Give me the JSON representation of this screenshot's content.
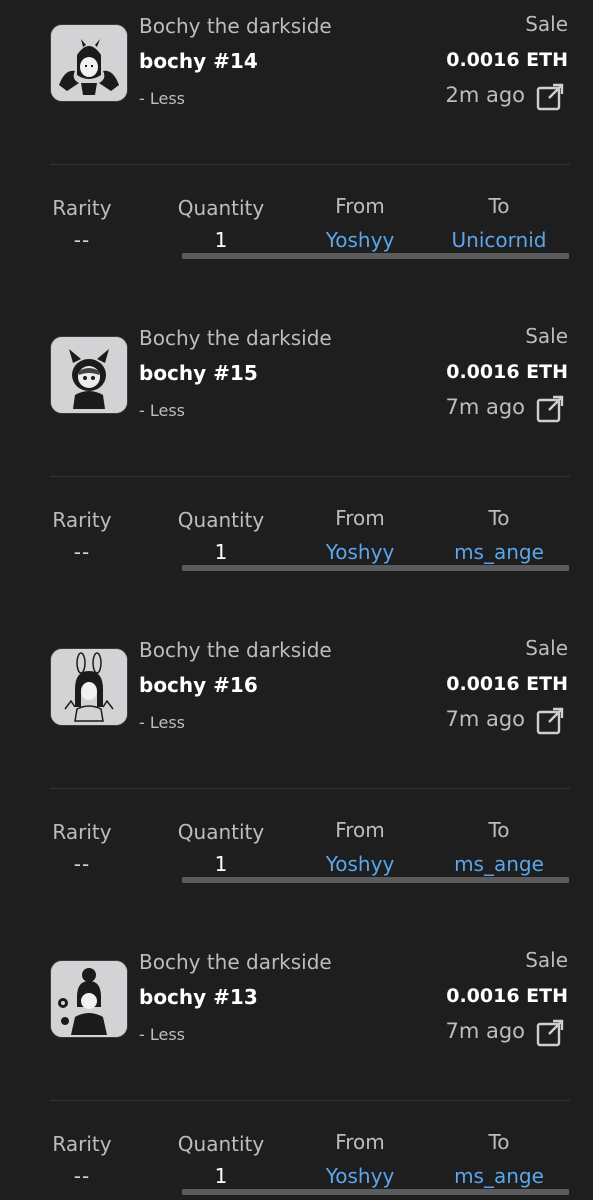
{
  "colors": {
    "background": "#1e1e1f",
    "link": "#5aa6ea",
    "primary_text": "#ffffff",
    "secondary_text": "#bdbdbd",
    "thumbnail_bg": "#d3d3d6"
  },
  "columns": {
    "rarity": "Rarity",
    "quantity": "Quantity",
    "from": "From",
    "to": "To"
  },
  "activities": [
    {
      "collection": "Bochy the darkside",
      "token": "bochy #14",
      "toggle": "- Less",
      "event": "Sale",
      "price": "0.0016 ETH",
      "time": "2m ago",
      "rarity": "--",
      "quantity": "1",
      "from": "Yoshyy",
      "to": "Unicornid",
      "thumbnail_icon": "avatar-bat-wings-icon"
    },
    {
      "collection": "Bochy the darkside",
      "token": "bochy #15",
      "toggle": "- Less",
      "event": "Sale",
      "price": "0.0016 ETH",
      "time": "7m ago",
      "rarity": "--",
      "quantity": "1",
      "from": "Yoshyy",
      "to": "ms_ange",
      "thumbnail_icon": "avatar-devil-horns-icon"
    },
    {
      "collection": "Bochy the darkside",
      "token": "bochy #16",
      "toggle": "- Less",
      "event": "Sale",
      "price": "0.0016 ETH",
      "time": "7m ago",
      "rarity": "--",
      "quantity": "1",
      "from": "Yoshyy",
      "to": "ms_ange",
      "thumbnail_icon": "avatar-bunny-ears-icon"
    },
    {
      "collection": "Bochy the darkside",
      "token": "bochy #13",
      "toggle": "- Less",
      "event": "Sale",
      "price": "0.0016 ETH",
      "time": "7m ago",
      "rarity": "--",
      "quantity": "1",
      "from": "Yoshyy",
      "to": "ms_ange",
      "thumbnail_icon": "avatar-bun-hair-icon"
    }
  ]
}
